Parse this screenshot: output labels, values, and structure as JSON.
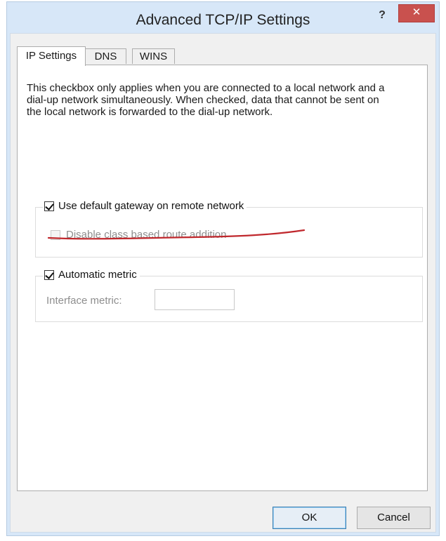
{
  "window": {
    "title": "Advanced TCP/IP Settings",
    "help_label": "?",
    "close_label": "✕"
  },
  "tabs": [
    {
      "label": "IP Settings",
      "active": true
    },
    {
      "label": "DNS",
      "active": false
    },
    {
      "label": "WINS",
      "active": false
    }
  ],
  "description": "This checkbox only applies when you are connected to a local network and a dial-up network simultaneously.  When checked, data that cannot be sent on the local network is forwarded to the dial-up network.",
  "gateway_group": {
    "use_default_gateway": {
      "label": "Use default gateway on remote network",
      "checked": true
    },
    "disable_class_route": {
      "label": "Disable class based route addition",
      "checked": false,
      "enabled": false
    }
  },
  "metric_group": {
    "automatic_metric": {
      "label": "Automatic metric",
      "checked": true
    },
    "interface_metric": {
      "label": "Interface metric:",
      "value": "",
      "enabled": false
    }
  },
  "buttons": {
    "ok": "OK",
    "cancel": "Cancel"
  },
  "colors": {
    "annotation_underline": "#c0282d",
    "close_button": "#c9514e",
    "frame": "#d7e7f8"
  }
}
